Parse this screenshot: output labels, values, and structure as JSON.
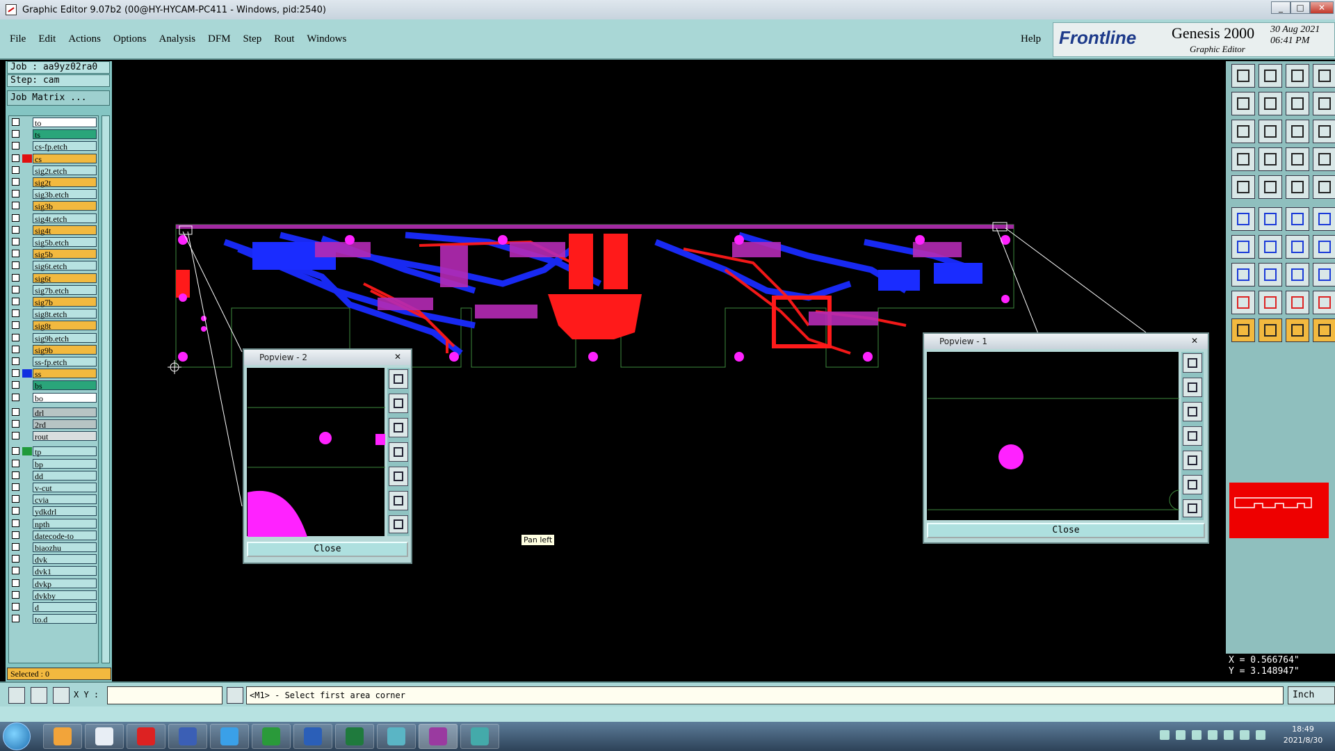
{
  "window": {
    "title": "Graphic Editor 9.07b2 (00@HY-HYCAM-PC411 - Windows, pid:2540)"
  },
  "menu": [
    "File",
    "Edit",
    "Actions",
    "Options",
    "Analysis",
    "DFM",
    "Step",
    "Rout",
    "Windows"
  ],
  "help_label": "Help",
  "brand": {
    "logo": "Frontline",
    "product": "Genesis 2000",
    "subtitle": "Graphic Editor",
    "date": "30 Aug 2021",
    "time": "06:41 PM"
  },
  "job": {
    "job_label": "Job : aa9yz02ra0",
    "step_label": "Step: cam",
    "matrix_button": "Job Matrix ..."
  },
  "layers": [
    {
      "name": "to",
      "color": "#ffffff",
      "swatch": ""
    },
    {
      "name": "ts",
      "color": "#2aa57a",
      "swatch": ""
    },
    {
      "name": "cs-fp.etch",
      "color": "#b7e2e1",
      "swatch": ""
    },
    {
      "name": "cs",
      "color": "#f2b93f",
      "swatch": "#e01010"
    },
    {
      "name": "sig2t.etch",
      "color": "#b7e2e1",
      "swatch": ""
    },
    {
      "name": "sig2t",
      "color": "#f2b93f",
      "swatch": ""
    },
    {
      "name": "sig3b.etch",
      "color": "#b7e2e1",
      "swatch": ""
    },
    {
      "name": "sig3b",
      "color": "#f2b93f",
      "swatch": ""
    },
    {
      "name": "sig4t.etch",
      "color": "#b7e2e1",
      "swatch": ""
    },
    {
      "name": "sig4t",
      "color": "#f2b93f",
      "swatch": ""
    },
    {
      "name": "sig5b.etch",
      "color": "#b7e2e1",
      "swatch": ""
    },
    {
      "name": "sig5b",
      "color": "#f2b93f",
      "swatch": ""
    },
    {
      "name": "sig6t.etch",
      "color": "#b7e2e1",
      "swatch": ""
    },
    {
      "name": "sig6t",
      "color": "#f2b93f",
      "swatch": ""
    },
    {
      "name": "sig7b.etch",
      "color": "#b7e2e1",
      "swatch": ""
    },
    {
      "name": "sig7b",
      "color": "#f2b93f",
      "swatch": ""
    },
    {
      "name": "sig8t.etch",
      "color": "#b7e2e1",
      "swatch": ""
    },
    {
      "name": "sig8t",
      "color": "#f2b93f",
      "swatch": ""
    },
    {
      "name": "sig9b.etch",
      "color": "#b7e2e1",
      "swatch": ""
    },
    {
      "name": "sig9b",
      "color": "#f2b93f",
      "swatch": ""
    },
    {
      "name": "ss-fp.etch",
      "color": "#b7e2e1",
      "swatch": ""
    },
    {
      "name": "ss",
      "color": "#f2b93f",
      "swatch": "#1030e0"
    },
    {
      "name": "bs",
      "color": "#2aa57a",
      "swatch": ""
    },
    {
      "name": "bo",
      "color": "#ffffff",
      "swatch": ""
    },
    {
      "name": "drl",
      "color": "#b7c4c4",
      "swatch": ""
    },
    {
      "name": "2rd",
      "color": "#b7c4c4",
      "swatch": ""
    },
    {
      "name": "rout",
      "color": "#d8dede",
      "swatch": ""
    },
    {
      "name": "tp",
      "color": "#b7e2e1",
      "swatch": "#1f9a3a"
    },
    {
      "name": "bp",
      "color": "#b7e2e1",
      "swatch": ""
    },
    {
      "name": "dd",
      "color": "#b7e2e1",
      "swatch": ""
    },
    {
      "name": "v-cut",
      "color": "#b7e2e1",
      "swatch": ""
    },
    {
      "name": "cvia",
      "color": "#b7e2e1",
      "swatch": ""
    },
    {
      "name": "ydkdrl",
      "color": "#b7e2e1",
      "swatch": ""
    },
    {
      "name": "npth",
      "color": "#b7e2e1",
      "swatch": ""
    },
    {
      "name": "datecode-to",
      "color": "#b7e2e1",
      "swatch": ""
    },
    {
      "name": "biaozhu",
      "color": "#b7e2e1",
      "swatch": ""
    },
    {
      "name": "dvk",
      "color": "#b7e2e1",
      "swatch": ""
    },
    {
      "name": "dvk1",
      "color": "#b7e2e1",
      "swatch": ""
    },
    {
      "name": "dvkp",
      "color": "#b7e2e1",
      "swatch": ""
    },
    {
      "name": "dvkby",
      "color": "#b7e2e1",
      "swatch": ""
    },
    {
      "name": "d",
      "color": "#b7e2e1",
      "swatch": ""
    },
    {
      "name": "to.d",
      "color": "#b7e2e1",
      "swatch": ""
    }
  ],
  "selected_label": "Selected : 0",
  "popview2": {
    "title": "Popview - 2",
    "close_label": "Close"
  },
  "popview1": {
    "title": "Popview - 1",
    "close_label": "Close"
  },
  "tooltip": "Pan left",
  "coords": {
    "x": "X = 0.566764\"",
    "y": "Y = 3.148947\""
  },
  "bottom": {
    "xy_label": "X Y :",
    "xy_value": "",
    "message": "<M1> - Select first area corner",
    "unit": "Inch"
  },
  "taskbar": {
    "time": "18:49",
    "date": "2021/8/30"
  },
  "colors": {
    "top_layer": "#ff1a1a",
    "bottom_layer": "#1a2cff",
    "pad": "#ff22ff",
    "outline": "#3e8a3e",
    "panel": "#a9d7d6"
  }
}
